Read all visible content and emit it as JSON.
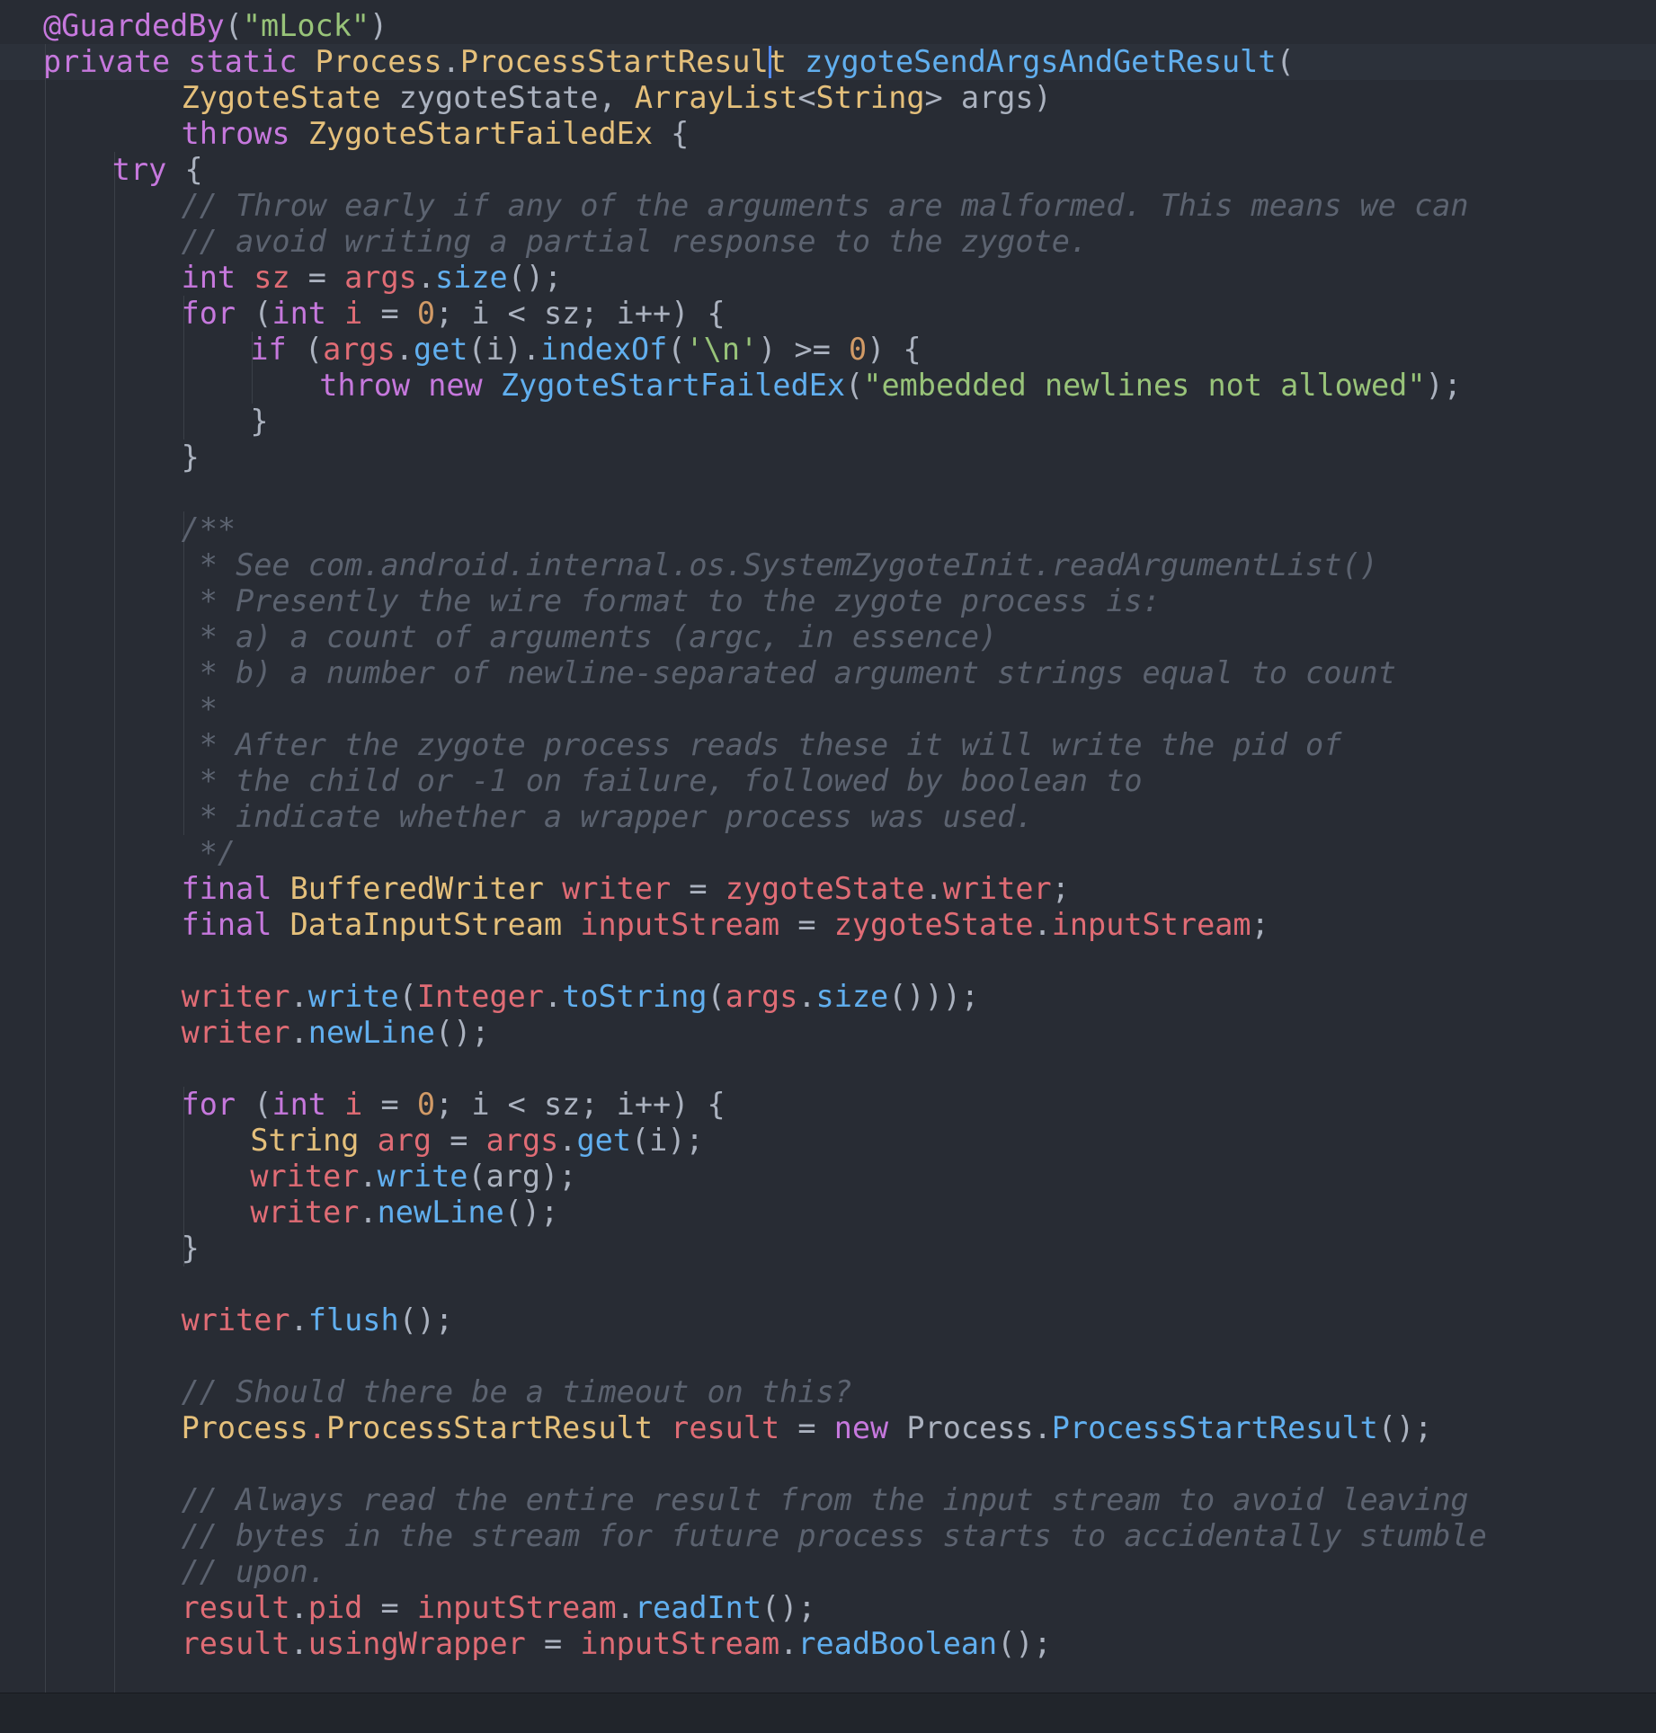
{
  "colors": {
    "background": "#282c34",
    "current_line": "#2c313a",
    "keyword": "#c678dd",
    "type": "#e5c07b",
    "function": "#61afef",
    "variable": "#e06c75",
    "string": "#98c379",
    "number": "#d19a66",
    "comment": "#5c6370",
    "text": "#abb2bf",
    "caret": "#528bff"
  },
  "lines": [
    {
      "indent": 0,
      "tokens": [
        [
          "ann",
          "@GuardedBy"
        ],
        [
          "p",
          "("
        ],
        [
          "s",
          "\"mLock\""
        ],
        [
          "p",
          ")"
        ]
      ]
    },
    {
      "indent": 0,
      "tokens": [
        [
          "k",
          "private"
        ],
        [
          "tx",
          " "
        ],
        [
          "k",
          "static"
        ],
        [
          "tx",
          " "
        ],
        [
          "t",
          "Process"
        ],
        [
          "p",
          "."
        ],
        [
          "t",
          "ProcessStartResult"
        ],
        [
          "tx",
          " "
        ],
        [
          "f",
          "zygoteSendArgsAndGetResult"
        ],
        [
          "p",
          "("
        ]
      ]
    },
    {
      "indent": 8,
      "tokens": [
        [
          "t",
          "ZygoteState"
        ],
        [
          "tx",
          " zygoteState, "
        ],
        [
          "t",
          "ArrayList"
        ],
        [
          "p",
          "<"
        ],
        [
          "t",
          "String"
        ],
        [
          "p",
          "> "
        ],
        [
          "tx",
          "args)"
        ]
      ]
    },
    {
      "indent": 8,
      "tokens": [
        [
          "k",
          "throws"
        ],
        [
          "tx",
          " "
        ],
        [
          "t",
          "ZygoteStartFailedEx"
        ],
        [
          "tx",
          " {"
        ]
      ]
    },
    {
      "indent": 4,
      "tokens": [
        [
          "k",
          "try"
        ],
        [
          "tx",
          " {"
        ]
      ]
    },
    {
      "indent": 8,
      "tokens": [
        [
          "c",
          "// Throw early if any of the arguments are malformed. This means we can"
        ]
      ]
    },
    {
      "indent": 8,
      "tokens": [
        [
          "c",
          "// avoid writing a partial response to the zygote."
        ]
      ]
    },
    {
      "indent": 8,
      "tokens": [
        [
          "k",
          "int"
        ],
        [
          "tx",
          " "
        ],
        [
          "v",
          "sz"
        ],
        [
          "tx",
          " = "
        ],
        [
          "v",
          "args"
        ],
        [
          "p",
          "."
        ],
        [
          "f",
          "size"
        ],
        [
          "p",
          "();"
        ]
      ]
    },
    {
      "indent": 8,
      "tokens": [
        [
          "k",
          "for"
        ],
        [
          "tx",
          " ("
        ],
        [
          "k",
          "int"
        ],
        [
          "tx",
          " "
        ],
        [
          "v",
          "i"
        ],
        [
          "tx",
          " = "
        ],
        [
          "n",
          "0"
        ],
        [
          "tx",
          "; i < sz; i++) {"
        ]
      ]
    },
    {
      "indent": 12,
      "tokens": [
        [
          "k",
          "if"
        ],
        [
          "tx",
          " ("
        ],
        [
          "v",
          "args"
        ],
        [
          "p",
          "."
        ],
        [
          "f",
          "get"
        ],
        [
          "p",
          "(i)."
        ],
        [
          "f",
          "indexOf"
        ],
        [
          "p",
          "("
        ],
        [
          "s",
          "'\\n'"
        ],
        [
          "p",
          ") >= "
        ],
        [
          "n",
          "0"
        ],
        [
          "p",
          ") {"
        ]
      ]
    },
    {
      "indent": 16,
      "tokens": [
        [
          "k",
          "throw"
        ],
        [
          "tx",
          " "
        ],
        [
          "k",
          "new"
        ],
        [
          "tx",
          " "
        ],
        [
          "f",
          "ZygoteStartFailedEx"
        ],
        [
          "p",
          "("
        ],
        [
          "s",
          "\"embedded newlines not allowed\""
        ],
        [
          "p",
          ");"
        ]
      ]
    },
    {
      "indent": 12,
      "tokens": [
        [
          "p",
          "}"
        ]
      ]
    },
    {
      "indent": 8,
      "tokens": [
        [
          "p",
          "}"
        ]
      ]
    },
    {
      "indent": 0,
      "tokens": []
    },
    {
      "indent": 8,
      "tokens": [
        [
          "c",
          "/**"
        ]
      ]
    },
    {
      "indent": 8,
      "tokens": [
        [
          "c",
          " * See com.android.internal.os.SystemZygoteInit.readArgumentList()"
        ]
      ]
    },
    {
      "indent": 8,
      "tokens": [
        [
          "c",
          " * Presently the wire format to the zygote process is:"
        ]
      ]
    },
    {
      "indent": 8,
      "tokens": [
        [
          "c",
          " * a) a count of arguments (argc, in essence)"
        ]
      ]
    },
    {
      "indent": 8,
      "tokens": [
        [
          "c",
          " * b) a number of newline-separated argument strings equal to count"
        ]
      ]
    },
    {
      "indent": 8,
      "tokens": [
        [
          "c",
          " *"
        ]
      ]
    },
    {
      "indent": 8,
      "tokens": [
        [
          "c",
          " * After the zygote process reads these it will write the pid of"
        ]
      ]
    },
    {
      "indent": 8,
      "tokens": [
        [
          "c",
          " * the child or -1 on failure, followed by boolean to"
        ]
      ]
    },
    {
      "indent": 8,
      "tokens": [
        [
          "c",
          " * indicate whether a wrapper process was used."
        ]
      ]
    },
    {
      "indent": 8,
      "tokens": [
        [
          "c",
          " */"
        ]
      ]
    },
    {
      "indent": 8,
      "tokens": [
        [
          "k",
          "final"
        ],
        [
          "tx",
          " "
        ],
        [
          "t",
          "BufferedWriter"
        ],
        [
          "tx",
          " "
        ],
        [
          "v",
          "writer"
        ],
        [
          "tx",
          " = "
        ],
        [
          "v",
          "zygoteState"
        ],
        [
          "p",
          "."
        ],
        [
          "v",
          "writer"
        ],
        [
          "p",
          ";"
        ]
      ]
    },
    {
      "indent": 8,
      "tokens": [
        [
          "k",
          "final"
        ],
        [
          "tx",
          " "
        ],
        [
          "t",
          "DataInputStream"
        ],
        [
          "tx",
          " "
        ],
        [
          "v",
          "inputStream"
        ],
        [
          "tx",
          " = "
        ],
        [
          "v",
          "zygoteState"
        ],
        [
          "p",
          "."
        ],
        [
          "v",
          "inputStream"
        ],
        [
          "p",
          ";"
        ]
      ]
    },
    {
      "indent": 0,
      "tokens": []
    },
    {
      "indent": 8,
      "tokens": [
        [
          "v",
          "writer"
        ],
        [
          "p",
          "."
        ],
        [
          "f",
          "write"
        ],
        [
          "p",
          "("
        ],
        [
          "v",
          "Integer"
        ],
        [
          "p",
          "."
        ],
        [
          "f",
          "toString"
        ],
        [
          "p",
          "("
        ],
        [
          "v",
          "args"
        ],
        [
          "p",
          "."
        ],
        [
          "f",
          "size"
        ],
        [
          "p",
          "()));"
        ]
      ]
    },
    {
      "indent": 8,
      "tokens": [
        [
          "v",
          "writer"
        ],
        [
          "p",
          "."
        ],
        [
          "f",
          "newLine"
        ],
        [
          "p",
          "();"
        ]
      ]
    },
    {
      "indent": 0,
      "tokens": []
    },
    {
      "indent": 8,
      "tokens": [
        [
          "k",
          "for"
        ],
        [
          "tx",
          " ("
        ],
        [
          "k",
          "int"
        ],
        [
          "tx",
          " "
        ],
        [
          "v",
          "i"
        ],
        [
          "tx",
          " = "
        ],
        [
          "n",
          "0"
        ],
        [
          "tx",
          "; i < sz; i++) {"
        ]
      ]
    },
    {
      "indent": 12,
      "tokens": [
        [
          "t",
          "String"
        ],
        [
          "tx",
          " "
        ],
        [
          "v",
          "arg"
        ],
        [
          "tx",
          " = "
        ],
        [
          "v",
          "args"
        ],
        [
          "p",
          "."
        ],
        [
          "f",
          "get"
        ],
        [
          "p",
          "(i);"
        ]
      ]
    },
    {
      "indent": 12,
      "tokens": [
        [
          "v",
          "writer"
        ],
        [
          "p",
          "."
        ],
        [
          "f",
          "write"
        ],
        [
          "p",
          "(arg);"
        ]
      ]
    },
    {
      "indent": 12,
      "tokens": [
        [
          "v",
          "writer"
        ],
        [
          "p",
          "."
        ],
        [
          "f",
          "newLine"
        ],
        [
          "p",
          "();"
        ]
      ]
    },
    {
      "indent": 8,
      "tokens": [
        [
          "p",
          "}"
        ]
      ]
    },
    {
      "indent": 0,
      "tokens": []
    },
    {
      "indent": 8,
      "tokens": [
        [
          "v",
          "writer"
        ],
        [
          "p",
          "."
        ],
        [
          "f",
          "flush"
        ],
        [
          "p",
          "();"
        ]
      ]
    },
    {
      "indent": 0,
      "tokens": []
    },
    {
      "indent": 8,
      "tokens": [
        [
          "c",
          "// Should there be a timeout on this?"
        ]
      ]
    },
    {
      "indent": 8,
      "tokens": [
        [
          "t",
          "Process"
        ],
        [
          "v",
          "."
        ],
        [
          "t",
          "ProcessStartResult"
        ],
        [
          "tx",
          " "
        ],
        [
          "v",
          "result"
        ],
        [
          "tx",
          " = "
        ],
        [
          "k",
          "new"
        ],
        [
          "tx",
          " Process."
        ],
        [
          "f",
          "ProcessStartResult"
        ],
        [
          "p",
          "();"
        ]
      ]
    },
    {
      "indent": 0,
      "tokens": []
    },
    {
      "indent": 8,
      "tokens": [
        [
          "c",
          "// Always read the entire result from the input stream to avoid leaving"
        ]
      ]
    },
    {
      "indent": 8,
      "tokens": [
        [
          "c",
          "// bytes in the stream for future process starts to accidentally stumble"
        ]
      ]
    },
    {
      "indent": 8,
      "tokens": [
        [
          "c",
          "// upon."
        ]
      ]
    },
    {
      "indent": 8,
      "tokens": [
        [
          "v",
          "result"
        ],
        [
          "p",
          "."
        ],
        [
          "v",
          "pid"
        ],
        [
          "tx",
          " = "
        ],
        [
          "v",
          "inputStream"
        ],
        [
          "p",
          "."
        ],
        [
          "f",
          "readInt"
        ],
        [
          "p",
          "();"
        ]
      ]
    },
    {
      "indent": 8,
      "tokens": [
        [
          "v",
          "result"
        ],
        [
          "p",
          "."
        ],
        [
          "v",
          "usingWrapper"
        ],
        [
          "tx",
          " = "
        ],
        [
          "v",
          "inputStream"
        ],
        [
          "p",
          "."
        ],
        [
          "f",
          "readBoolean"
        ],
        [
          "p",
          "();"
        ]
      ]
    }
  ]
}
